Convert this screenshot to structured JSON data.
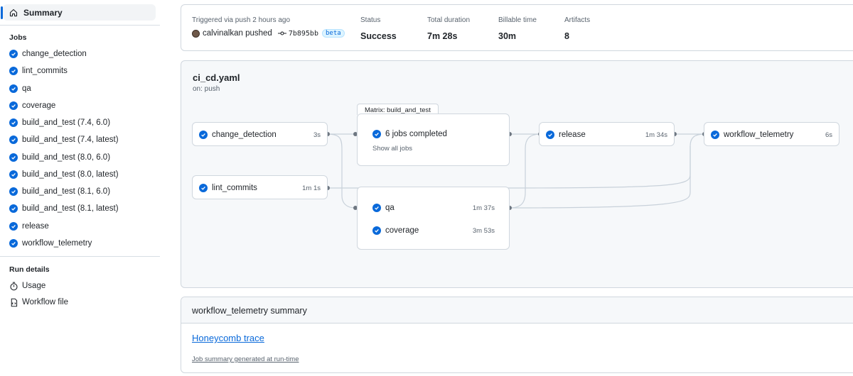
{
  "sidebar": {
    "summary_label": "Summary",
    "jobs_heading": "Jobs",
    "jobs": [
      {
        "label": "change_detection"
      },
      {
        "label": "lint_commits"
      },
      {
        "label": "qa"
      },
      {
        "label": "coverage"
      },
      {
        "label": "build_and_test (7.4, 6.0)"
      },
      {
        "label": "build_and_test (7.4, latest)"
      },
      {
        "label": "build_and_test (8.0, 6.0)"
      },
      {
        "label": "build_and_test (8.0, latest)"
      },
      {
        "label": "build_and_test (8.1, 6.0)"
      },
      {
        "label": "build_and_test (8.1, latest)"
      },
      {
        "label": "release"
      },
      {
        "label": "workflow_telemetry"
      }
    ],
    "run_details_heading": "Run details",
    "usage_label": "Usage",
    "workflow_file_label": "Workflow file"
  },
  "header": {
    "trigger_text": "Triggered via push 2 hours ago",
    "actor_text": "calvinalkan pushed",
    "commit_sha": "7b895bb",
    "branch_badge": "beta",
    "status_label": "Status",
    "status_value": "Success",
    "duration_label": "Total duration",
    "duration_value": "7m 28s",
    "billable_label": "Billable time",
    "billable_value": "30m",
    "artifacts_label": "Artifacts",
    "artifacts_value": "8"
  },
  "graph": {
    "title": "ci_cd.yaml",
    "subtitle": "on: push",
    "nodes": {
      "change_detection": {
        "name": "change_detection",
        "time": "3s"
      },
      "lint_commits": {
        "name": "lint_commits",
        "time": "1m 1s"
      },
      "matrix": {
        "tab": "Matrix: build_and_test",
        "name": "6 jobs completed",
        "link": "Show all jobs"
      },
      "qa": {
        "name": "qa",
        "time": "1m 37s"
      },
      "coverage": {
        "name": "coverage",
        "time": "3m 53s"
      },
      "release": {
        "name": "release",
        "time": "1m 34s"
      },
      "workflow_telemetry": {
        "name": "workflow_telemetry",
        "time": "6s"
      }
    }
  },
  "summary": {
    "title": "workflow_telemetry summary",
    "link": "Honeycomb trace",
    "footer": "Job summary generated at run-time"
  },
  "colors": {
    "accent": "#0969da",
    "border": "#d0d7de",
    "success": "#0969da"
  }
}
